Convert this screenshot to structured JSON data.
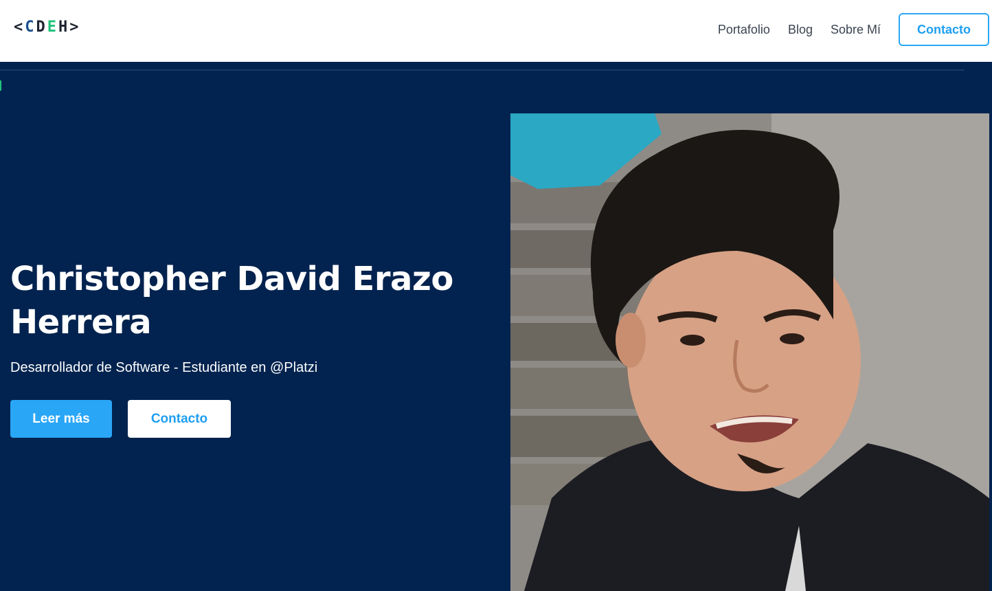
{
  "header": {
    "logo": {
      "open": "<",
      "letters": [
        "C",
        "D",
        "E",
        "H"
      ],
      "close": ">"
    },
    "nav": {
      "portfolio": "Portafolio",
      "blog": "Blog",
      "about": "Sobre Mí",
      "contact": "Contacto"
    }
  },
  "hero": {
    "title": "Christopher David Erazo Herrera",
    "subtitle": "Desarrollador de Software - Estudiante en @Platzi",
    "read_more": "Leer más",
    "contact": "Contacto"
  },
  "colors": {
    "hero_bg": "#02234f",
    "accent": "#2aa6f7",
    "logo_c": "#1b4f8f",
    "logo_d": "#1d2330",
    "logo_e": "#1ec27a",
    "logo_h": "#1d2330"
  }
}
